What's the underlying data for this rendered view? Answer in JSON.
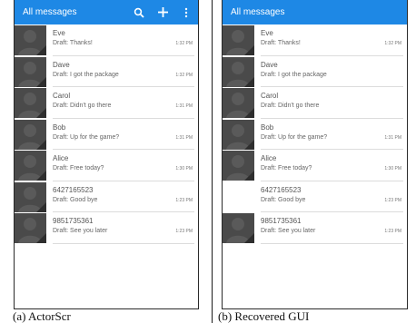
{
  "left_screen": {
    "title": "All messages",
    "actions": [
      {
        "icon": "search-icon"
      },
      {
        "icon": "plus-icon"
      },
      {
        "icon": "more-vert-icon"
      }
    ],
    "messages": [
      {
        "name": "Eve",
        "draft": "Draft: Thanks!",
        "time": "1:32 PM",
        "avatar": true
      },
      {
        "name": "Dave",
        "draft": "Draft: I got the package",
        "time": "1:32 PM",
        "avatar": true
      },
      {
        "name": "Carol",
        "draft": "Draft: Didn't go there",
        "time": "1:31 PM",
        "avatar": true
      },
      {
        "name": "Bob",
        "draft": "Draft: Up for the game?",
        "time": "1:31 PM",
        "avatar": true
      },
      {
        "name": "Alice",
        "draft": "Draft: Free today?",
        "time": "1:30 PM",
        "avatar": true
      },
      {
        "name": "6427165523",
        "draft": "Draft: Good bye",
        "time": "1:23 PM",
        "avatar": true
      },
      {
        "name": "9851735361",
        "draft": "Draft: See you later",
        "time": "1:23 PM",
        "avatar": true
      }
    ]
  },
  "right_screen": {
    "title": "All messages",
    "messages": [
      {
        "name": "Eve",
        "draft": "Draft: Thanks!",
        "time": "1:32 PM",
        "avatar": true
      },
      {
        "name": "Dave",
        "draft": "Draft: I got the package",
        "time": "",
        "avatar": true
      },
      {
        "name": "Carol",
        "draft": "Draft: Didn't go there",
        "time": "",
        "avatar": true
      },
      {
        "name": "Bob",
        "draft": "Draft: Up for the game?",
        "time": "1:31 PM",
        "avatar": true
      },
      {
        "name": "Alice",
        "draft": "Draft: Free today?",
        "time": "1:30 PM",
        "avatar": true
      },
      {
        "name": "6427165523",
        "draft": "Draft: Good bye",
        "time": "1:23 PM",
        "avatar": false
      },
      {
        "name": "9851735361",
        "draft": "Draft: See you later",
        "time": "1:23 PM",
        "avatar": true
      }
    ]
  },
  "captions": {
    "left": "(a) ActorScr",
    "right": "(b) Recovered GUI"
  },
  "colors": {
    "appbar": "#1e88e5",
    "avatar_bg": "#4a4a4a"
  }
}
